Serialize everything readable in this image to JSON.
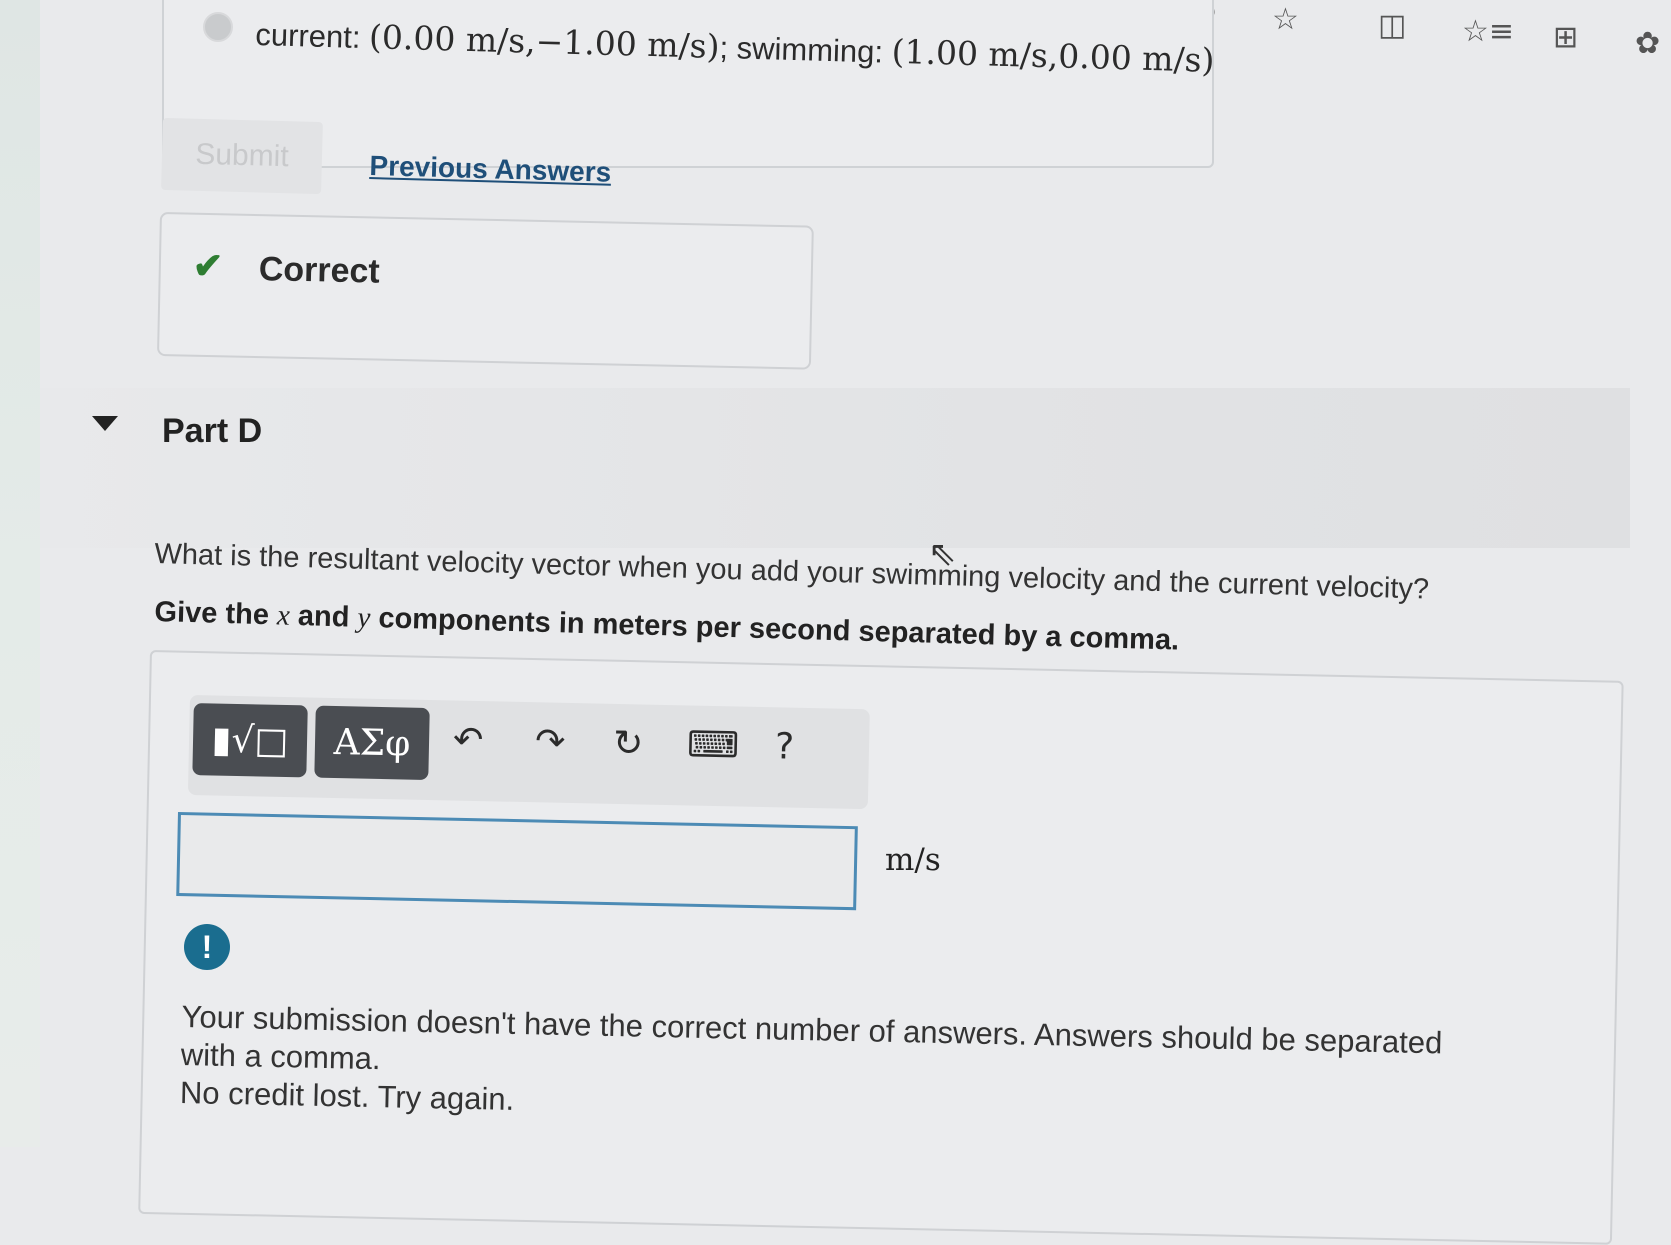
{
  "browser_toolbar": {
    "read_aloud_label": "A⁾",
    "favorite_icon": "☆",
    "split_icon": "◫",
    "favorites_icon": "☆≡",
    "collections_icon": "⊞",
    "copilot_icon": "✿"
  },
  "answer_option": {
    "label_current": "current: ",
    "current_value": "(0.00 m/s,−1.00 m/s)",
    "label_swimming": "; swimming: ",
    "swimming_value": "(1.00 m/s,0.00 m/s)"
  },
  "actions": {
    "submit_label": "Submit",
    "previous_answers_label": "Previous Answers"
  },
  "result": {
    "check_icon": "✔",
    "label": "Correct"
  },
  "part": {
    "title": "Part D",
    "question": "What is the resultant velocity vector when you add your swimming velocity and the current velocity?",
    "instruction_prefix": "Give the ",
    "instruction_x": "x",
    "instruction_mid": " and ",
    "instruction_y": "y",
    "instruction_suffix": " components in meters per second separated by a comma."
  },
  "editor": {
    "template_button": "▮√□",
    "greek_button": "ΑΣφ",
    "undo_icon": "↶",
    "redo_icon": "↷",
    "reset_icon": "↻",
    "keyboard_icon": "⌨",
    "help_label": "?"
  },
  "answer_field": {
    "value": "",
    "unit": "m/s"
  },
  "feedback": {
    "alert_icon": "!",
    "line1": "Your submission doesn't have the correct number of answers. Answers should be separated with a comma.",
    "line2": "No credit lost. Try again."
  },
  "cursor_icon": "⇖"
}
